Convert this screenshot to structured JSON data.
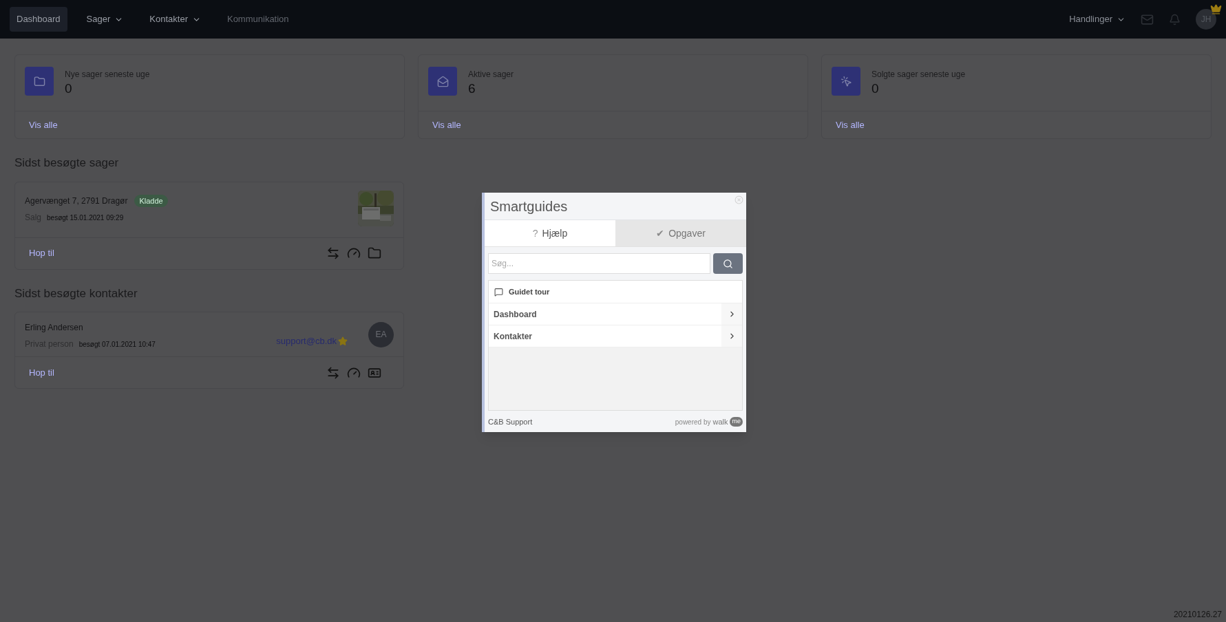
{
  "nav": {
    "items": [
      {
        "label": "Dashboard",
        "selected": true,
        "dropdown": false,
        "disabled": false
      },
      {
        "label": "Sager",
        "selected": false,
        "dropdown": true,
        "disabled": false
      },
      {
        "label": "Kontakter",
        "selected": false,
        "dropdown": true,
        "disabled": false
      },
      {
        "label": "Kommunikation",
        "selected": false,
        "dropdown": false,
        "disabled": true
      }
    ]
  },
  "actions": {
    "label": "Handlinger"
  },
  "avatar": {
    "initials": "JH",
    "crown": true
  },
  "stats": [
    {
      "kind": "folder",
      "label": "Nye sager seneste uge",
      "value": "0",
      "link": "Vis alle"
    },
    {
      "kind": "envelope",
      "label": "Aktive sager",
      "value": "6",
      "link": "Vis alle"
    },
    {
      "kind": "cursor",
      "label": "Solgte sager seneste uge",
      "value": "0",
      "link": "Vis alle"
    }
  ],
  "recent_cases": {
    "title": "Sidst besøgte sager",
    "items": [
      {
        "address": "Agervænget 7, 2791 Dragør",
        "badge": "Kladde",
        "type": "Salg",
        "visited": "besøgt 15.01.2021 09:29",
        "link": "Hop til"
      }
    ]
  },
  "recent_contacts": {
    "title": "Sidst besøgte kontakter",
    "items": [
      {
        "name": "Erling Andersen",
        "type": "Privat person",
        "visited": "besøgt 07.01.2021 10:47",
        "email": "support@cb.dk",
        "starred": true,
        "initials": "EA",
        "link": "Hop til"
      }
    ]
  },
  "modal": {
    "title": "Smartguides",
    "tabs": [
      {
        "label": "Hjælp",
        "icon": "?",
        "selected": true
      },
      {
        "label": "Opgaver",
        "icon": "✔",
        "selected": false
      }
    ],
    "search": {
      "placeholder": "Søg..."
    },
    "items": [
      {
        "kind": "tour",
        "label": "Guidet tour"
      },
      {
        "kind": "page",
        "label": "Dashboard"
      },
      {
        "kind": "page",
        "label": "Kontakter"
      }
    ],
    "footer": {
      "support": "C&B Support",
      "powered_by": "powered by",
      "brand": "walk",
      "brand_badge": "me"
    }
  },
  "version": "20210126.27"
}
